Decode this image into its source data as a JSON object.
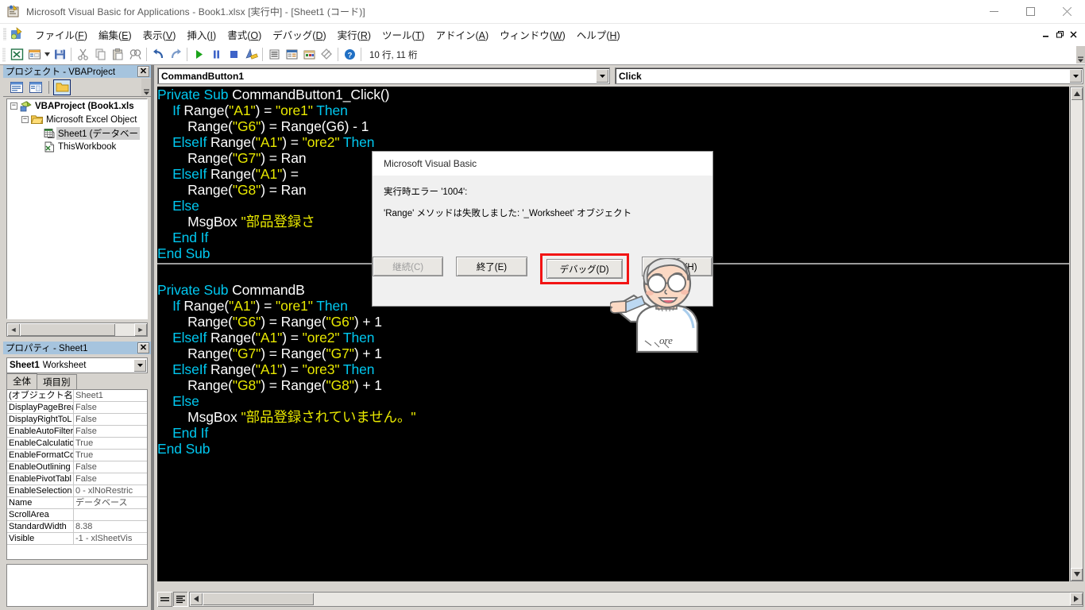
{
  "window": {
    "title": "Microsoft Visual Basic for Applications - Book1.xlsx [実行中] - [Sheet1 (コード)]",
    "app_icon": "vba-app-icon",
    "minimize": "−",
    "maximize": "□",
    "close": "✕",
    "mdi_minimize": "−",
    "mdi_restore": "❐",
    "mdi_close": "✕"
  },
  "menubar": {
    "app_icon": "vba-menu-icon",
    "items": [
      {
        "label": "ファイル(",
        "accel": "F",
        "tail": ")",
        "name": "menu-file"
      },
      {
        "label": "編集(",
        "accel": "E",
        "tail": ")",
        "name": "menu-edit"
      },
      {
        "label": "表示(",
        "accel": "V",
        "tail": ")",
        "name": "menu-view"
      },
      {
        "label": "挿入(",
        "accel": "I",
        "tail": ")",
        "name": "menu-insert"
      },
      {
        "label": "書式(",
        "accel": "O",
        "tail": ")",
        "name": "menu-format"
      },
      {
        "label": "デバッグ(",
        "accel": "D",
        "tail": ")",
        "name": "menu-debug"
      },
      {
        "label": "実行(",
        "accel": "R",
        "tail": ")",
        "name": "menu-run"
      },
      {
        "label": "ツール(",
        "accel": "T",
        "tail": ")",
        "name": "menu-tools"
      },
      {
        "label": "アドイン(",
        "accel": "A",
        "tail": ")",
        "name": "menu-addins"
      },
      {
        "label": "ウィンドウ(",
        "accel": "W",
        "tail": ")",
        "name": "menu-window"
      },
      {
        "label": "ヘルプ(",
        "accel": "H",
        "tail": ")",
        "name": "menu-help"
      }
    ]
  },
  "toolbar": {
    "position_indicator": "10 行, 11 桁",
    "icons": [
      "excel-view-icon",
      "userform-icon",
      "dropdown-arrow-icon",
      "save-icon",
      "cut-icon",
      "copy-icon",
      "paste-icon",
      "find-icon",
      "undo-icon",
      "redo-icon",
      "run-icon",
      "break-icon",
      "reset-icon",
      "design-mode-icon",
      "project-explorer-icon",
      "properties-window-icon",
      "object-browser-icon",
      "toolbox-icon",
      "help-icon"
    ],
    "overflow": "▼"
  },
  "project_explorer": {
    "caption": "プロジェクト - VBAProject",
    "close_label": "✕",
    "toolbar_buttons": [
      "view-code-icon",
      "view-object-icon",
      "toggle-folders-icon"
    ],
    "tree": [
      {
        "label": "VBAProject (Book1.xls",
        "depth": 0,
        "expander": "−",
        "icon": "vbaproject-icon",
        "bold": true,
        "selected": false
      },
      {
        "label": "Microsoft Excel Object",
        "depth": 1,
        "expander": "−",
        "icon": "folder-icon",
        "bold": false,
        "selected": false
      },
      {
        "label": "Sheet1 (データベー",
        "depth": 2,
        "expander": "",
        "icon": "worksheet-icon",
        "bold": false,
        "selected": true
      },
      {
        "label": "ThisWorkbook",
        "depth": 2,
        "expander": "",
        "icon": "workbook-icon",
        "bold": false,
        "selected": false
      }
    ]
  },
  "properties_window": {
    "caption": "プロパティ - Sheet1",
    "close_label": "✕",
    "object_name": "Sheet1",
    "object_type": "Worksheet",
    "dropdown_arrow": "▼",
    "tabs": [
      {
        "label": "全体",
        "active": true,
        "name": "tab-alphabetic"
      },
      {
        "label": "項目別",
        "active": false,
        "name": "tab-categorized"
      }
    ],
    "rows": [
      {
        "name": "(オブジェクト名)",
        "value": "Sheet1"
      },
      {
        "name": "DisplayPageBrea",
        "value": "False"
      },
      {
        "name": "DisplayRightToL",
        "value": "False"
      },
      {
        "name": "EnableAutoFilter",
        "value": "False"
      },
      {
        "name": "EnableCalculatio",
        "value": "True"
      },
      {
        "name": "EnableFormatCo",
        "value": "True"
      },
      {
        "name": "EnableOutlining",
        "value": "False"
      },
      {
        "name": "EnablePivotTabl",
        "value": "False"
      },
      {
        "name": "EnableSelection",
        "value": "0 - xlNoRestric"
      },
      {
        "name": "Name",
        "value": "データベース"
      },
      {
        "name": "ScrollArea",
        "value": ""
      },
      {
        "name": "StandardWidth",
        "value": "8.38"
      },
      {
        "name": "Visible",
        "value": "-1 - xlSheetVis"
      }
    ]
  },
  "code_window": {
    "object_combo": "CommandButton1",
    "procedure_combo": "Click",
    "dropdown_arrow": "▼",
    "view_buttons": [
      "procedure-view-icon",
      "full-module-view-icon"
    ],
    "code": [
      [
        {
          "t": "Private Sub ",
          "c": "kw"
        },
        {
          "t": "CommandButton1_Click()",
          "c": ""
        }
      ],
      [
        {
          "t": "    ",
          "c": ""
        },
        {
          "t": "If ",
          "c": "kw"
        },
        {
          "t": "Range(",
          "c": ""
        },
        {
          "t": "\"A1\"",
          "c": "str"
        },
        {
          "t": ") = ",
          "c": ""
        },
        {
          "t": "\"ore1\"",
          "c": "str"
        },
        {
          "t": " ",
          "c": ""
        },
        {
          "t": "Then",
          "c": "kw"
        }
      ],
      [
        {
          "t": "        Range(",
          "c": ""
        },
        {
          "t": "\"G6\"",
          "c": "str"
        },
        {
          "t": ") = Range(G6) - 1",
          "c": ""
        }
      ],
      [
        {
          "t": "    ",
          "c": ""
        },
        {
          "t": "ElseIf ",
          "c": "kw"
        },
        {
          "t": "Range(",
          "c": ""
        },
        {
          "t": "\"A1\"",
          "c": "str"
        },
        {
          "t": ") = ",
          "c": ""
        },
        {
          "t": "\"ore2\"",
          "c": "str"
        },
        {
          "t": " ",
          "c": ""
        },
        {
          "t": "Then",
          "c": "kw"
        }
      ],
      [
        {
          "t": "        Range(",
          "c": ""
        },
        {
          "t": "\"G7\"",
          "c": "str"
        },
        {
          "t": ") = Ran",
          "c": ""
        }
      ],
      [
        {
          "t": "    ",
          "c": ""
        },
        {
          "t": "ElseIf ",
          "c": "kw"
        },
        {
          "t": "Range(",
          "c": ""
        },
        {
          "t": "\"A1\"",
          "c": "str"
        },
        {
          "t": ") = ",
          "c": ""
        }
      ],
      [
        {
          "t": "        Range(",
          "c": ""
        },
        {
          "t": "\"G8\"",
          "c": "str"
        },
        {
          "t": ") = Ran",
          "c": ""
        }
      ],
      [
        {
          "t": "    ",
          "c": ""
        },
        {
          "t": "Else",
          "c": "kw"
        }
      ],
      [
        {
          "t": "        MsgBox ",
          "c": ""
        },
        {
          "t": "\"部品登録さ",
          "c": "str"
        }
      ],
      [
        {
          "t": "    ",
          "c": ""
        },
        {
          "t": "End If",
          "c": "kw"
        }
      ],
      [
        {
          "t": "",
          "c": ""
        },
        {
          "t": "End Sub",
          "c": "kw"
        }
      ],
      [
        {
          "t": "SEPARATOR",
          "c": "sep"
        }
      ],
      [
        {
          "t": "",
          "c": ""
        }
      ],
      [
        {
          "t": "Private Sub ",
          "c": "kw"
        },
        {
          "t": "CommandB",
          "c": ""
        }
      ],
      [
        {
          "t": "    ",
          "c": ""
        },
        {
          "t": "If ",
          "c": "kw"
        },
        {
          "t": "Range(",
          "c": ""
        },
        {
          "t": "\"A1\"",
          "c": "str"
        },
        {
          "t": ") = ",
          "c": ""
        },
        {
          "t": "\"ore1\"",
          "c": "str"
        },
        {
          "t": " ",
          "c": ""
        },
        {
          "t": "Then",
          "c": "kw"
        }
      ],
      [
        {
          "t": "        Range(",
          "c": ""
        },
        {
          "t": "\"G6\"",
          "c": "str"
        },
        {
          "t": ") = Range(",
          "c": ""
        },
        {
          "t": "\"G6\"",
          "c": "str"
        },
        {
          "t": ") + 1",
          "c": ""
        }
      ],
      [
        {
          "t": "    ",
          "c": ""
        },
        {
          "t": "ElseIf ",
          "c": "kw"
        },
        {
          "t": "Range(",
          "c": ""
        },
        {
          "t": "\"A1\"",
          "c": "str"
        },
        {
          "t": ") = ",
          "c": ""
        },
        {
          "t": "\"ore2\"",
          "c": "str"
        },
        {
          "t": " ",
          "c": ""
        },
        {
          "t": "Then",
          "c": "kw"
        }
      ],
      [
        {
          "t": "        Range(",
          "c": ""
        },
        {
          "t": "\"G7\"",
          "c": "str"
        },
        {
          "t": ") = Range(",
          "c": ""
        },
        {
          "t": "\"G7\"",
          "c": "str"
        },
        {
          "t": ") + 1",
          "c": ""
        }
      ],
      [
        {
          "t": "    ",
          "c": ""
        },
        {
          "t": "ElseIf ",
          "c": "kw"
        },
        {
          "t": "Range(",
          "c": ""
        },
        {
          "t": "\"A1\"",
          "c": "str"
        },
        {
          "t": ") = ",
          "c": ""
        },
        {
          "t": "\"ore3\"",
          "c": "str"
        },
        {
          "t": " ",
          "c": ""
        },
        {
          "t": "Then",
          "c": "kw"
        }
      ],
      [
        {
          "t": "        Range(",
          "c": ""
        },
        {
          "t": "\"G8\"",
          "c": "str"
        },
        {
          "t": ") = Range(",
          "c": ""
        },
        {
          "t": "\"G8\"",
          "c": "str"
        },
        {
          "t": ") + 1",
          "c": ""
        }
      ],
      [
        {
          "t": "    ",
          "c": ""
        },
        {
          "t": "Else",
          "c": "kw"
        }
      ],
      [
        {
          "t": "        MsgBox ",
          "c": ""
        },
        {
          "t": "\"部品登録されていません。\"",
          "c": "str"
        }
      ],
      [
        {
          "t": "    ",
          "c": ""
        },
        {
          "t": "End If",
          "c": "kw"
        }
      ],
      [
        {
          "t": "",
          "c": ""
        },
        {
          "t": "End Sub",
          "c": "kw"
        }
      ]
    ]
  },
  "error_dialog": {
    "title": "Microsoft Visual Basic",
    "line1": "実行時エラー '1004':",
    "line2": "'Range' メソッドは失敗しました: '_Worksheet' オブジェクト",
    "buttons": [
      {
        "label": "継続(C)",
        "disabled": true,
        "highlighted": false,
        "name": "continue-button"
      },
      {
        "label": "終了(E)",
        "disabled": false,
        "highlighted": false,
        "name": "end-button"
      },
      {
        "label": "デバッグ(D)",
        "disabled": false,
        "highlighted": true,
        "name": "debug-button"
      },
      {
        "label": "ヘルプ(H)",
        "disabled": false,
        "highlighted": false,
        "name": "help-button"
      }
    ],
    "highlight_color": "#f21414"
  },
  "mascot": {
    "name": "pointing-character-illustration",
    "shirt_text": "ore"
  }
}
